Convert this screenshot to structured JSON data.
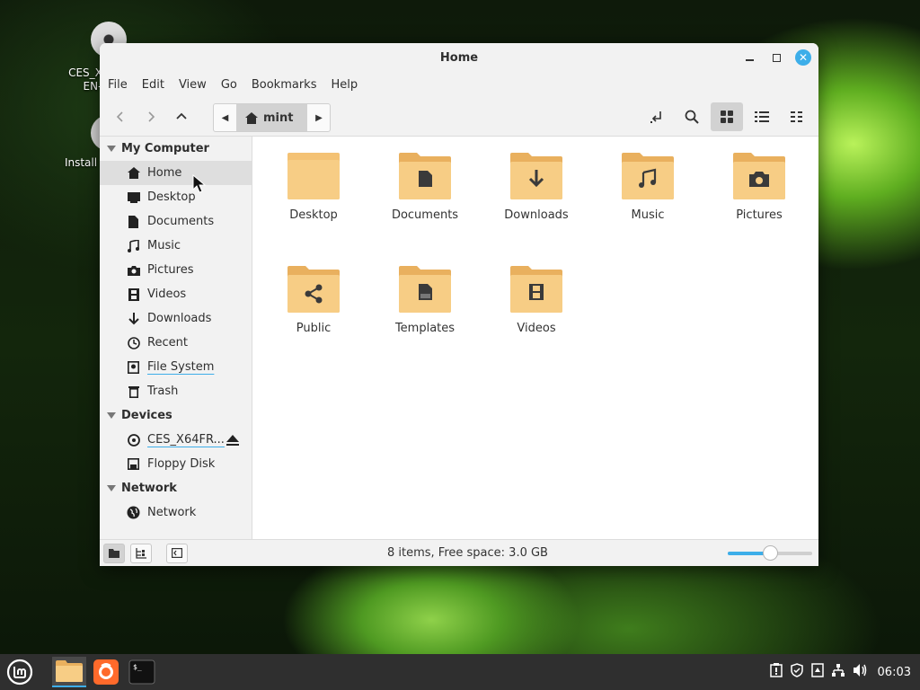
{
  "desktop": {
    "icon1_label": "CES_X\nEN-",
    "icon1_line1": "CES_X",
    "icon1_line2": "EN-",
    "icon2_label": "Install"
  },
  "window": {
    "title": "Home"
  },
  "menu": [
    "File",
    "Edit",
    "View",
    "Go",
    "Bookmarks",
    "Help"
  ],
  "path": {
    "crumb": "mint"
  },
  "sidebar": {
    "sections": [
      {
        "title": "My Computer",
        "items": [
          {
            "label": "Home",
            "icon": "home-icon"
          },
          {
            "label": "Desktop",
            "icon": "desktop-icon"
          },
          {
            "label": "Documents",
            "icon": "document-icon"
          },
          {
            "label": "Music",
            "icon": "music-icon"
          },
          {
            "label": "Pictures",
            "icon": "camera-icon"
          },
          {
            "label": "Videos",
            "icon": "film-icon"
          },
          {
            "label": "Downloads",
            "icon": "download-icon"
          },
          {
            "label": "Recent",
            "icon": "clock-icon"
          },
          {
            "label": "File System",
            "icon": "drive-icon"
          },
          {
            "label": "Trash",
            "icon": "trash-icon"
          }
        ]
      },
      {
        "title": "Devices",
        "items": [
          {
            "label": "CES_X64FR...",
            "icon": "disc-icon"
          },
          {
            "label": "Floppy Disk",
            "icon": "floppy-icon"
          }
        ]
      },
      {
        "title": "Network",
        "items": [
          {
            "label": "Network",
            "icon": "globe-icon"
          }
        ]
      }
    ]
  },
  "folders": [
    {
      "label": "Desktop",
      "emblem": "none"
    },
    {
      "label": "Documents",
      "emblem": "document-icon"
    },
    {
      "label": "Downloads",
      "emblem": "download-icon"
    },
    {
      "label": "Music",
      "emblem": "music-icon"
    },
    {
      "label": "Pictures",
      "emblem": "camera-icon"
    },
    {
      "label": "Public",
      "emblem": "share-icon"
    },
    {
      "label": "Templates",
      "emblem": "template-icon"
    },
    {
      "label": "Videos",
      "emblem": "film-icon"
    }
  ],
  "status": {
    "text": "8 items, Free space: 3.0 GB",
    "zoom_level": 0.5
  },
  "taskbar": {
    "clock": "06:03",
    "apps": [
      "files-icon",
      "firefox-icon",
      "terminal-icon"
    ]
  },
  "colors": {
    "accent": "#3daee9",
    "folder": "#f6c97a",
    "folder_dark": "#eab463"
  }
}
